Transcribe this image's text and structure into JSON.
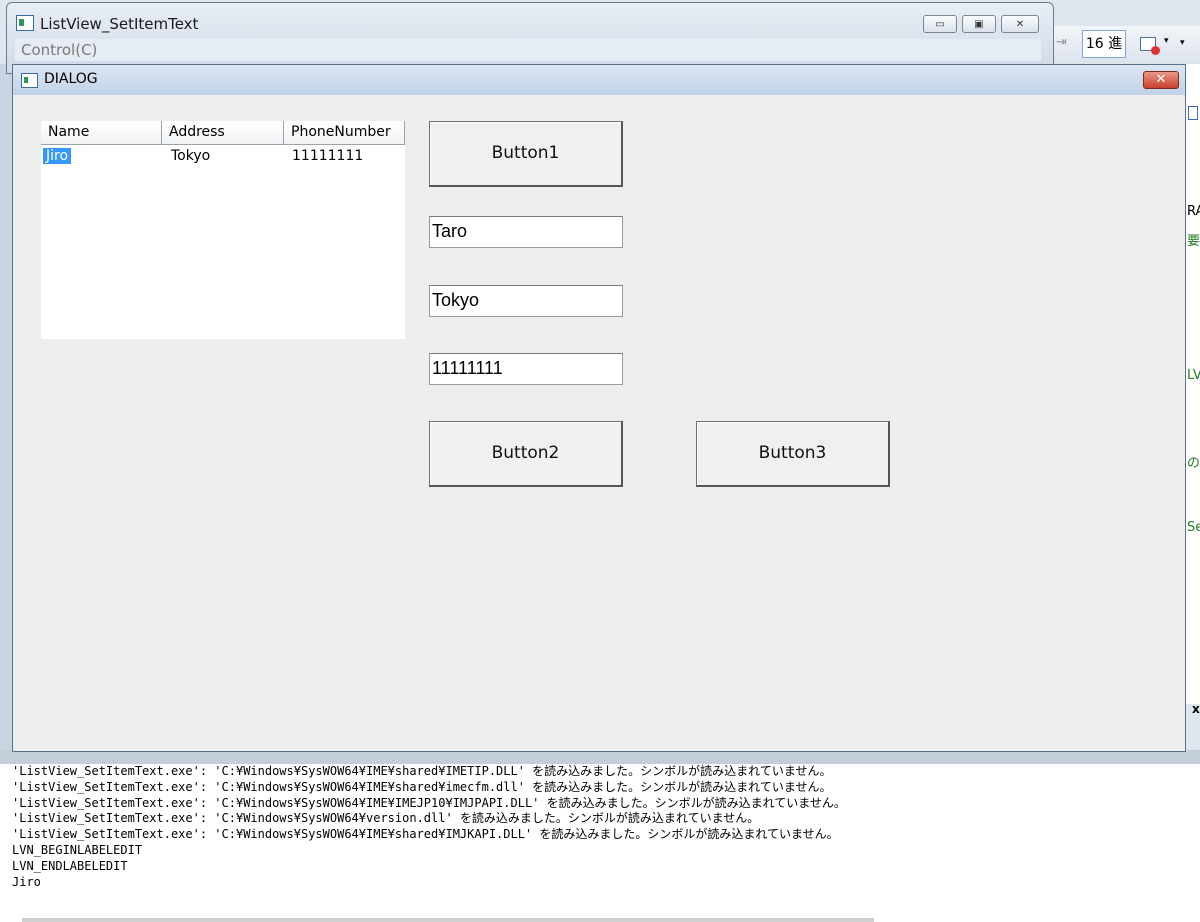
{
  "main_window": {
    "title": "ListView_SetItemText",
    "menu": [
      "Control(C)"
    ],
    "min_glyph": "▭",
    "max_glyph": "▣",
    "close_glyph": "✕"
  },
  "toolbar": {
    "hex_label": "16 進",
    "dropdown_glyph": "▾",
    "overflow_glyph": "▾"
  },
  "right_strip": {
    "ra": "RA",
    "y1": "要",
    "lvn": "LVN",
    "no": "の",
    "se": "Se",
    "x": "x"
  },
  "dialog": {
    "title": "DIALOG",
    "close_glyph": "✕",
    "listview": {
      "columns": [
        "Name",
        "Address",
        "PhoneNumber"
      ],
      "rows": [
        {
          "name": "Jiro",
          "address": "Tokyo",
          "phone": "11111111",
          "selected": true
        }
      ]
    },
    "button1": "Button1",
    "button2": "Button2",
    "button3": "Button3",
    "edit_name": "Taro",
    "edit_address": "Tokyo",
    "edit_phone": "11111111"
  },
  "output": {
    "lines": [
      "'ListView_SetItemText.exe': 'C:¥Windows¥SysWOW64¥IME¥shared¥IMETIP.DLL' を読み込みました。シンボルが読み込まれていません。",
      "'ListView_SetItemText.exe': 'C:¥Windows¥SysWOW64¥IME¥shared¥imecfm.dll' を読み込みました。シンボルが読み込まれていません。",
      "'ListView_SetItemText.exe': 'C:¥Windows¥SysWOW64¥IME¥IMEJP10¥IMJPAPI.DLL' を読み込みました。シンボルが読み込まれていません。",
      "'ListView_SetItemText.exe': 'C:¥Windows¥SysWOW64¥version.dll' を読み込みました。シンボルが読み込まれていません。",
      "'ListView_SetItemText.exe': 'C:¥Windows¥SysWOW64¥IME¥shared¥IMJKAPI.DLL' を読み込みました。シンボルが読み込まれていません。",
      "LVN_BEGINLABELEDIT",
      "LVN_ENDLABELEDIT",
      "Jiro"
    ]
  },
  "colors": {
    "selection": "#3399ff",
    "close_red": "#c8402d",
    "code_green": "#1e7a1e"
  }
}
